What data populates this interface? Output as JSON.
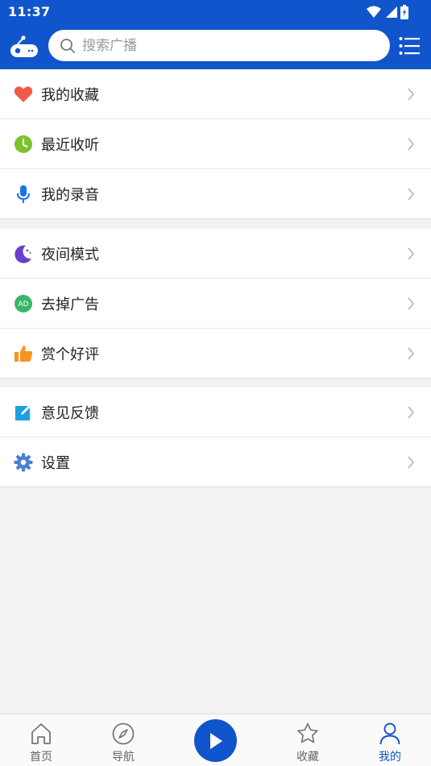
{
  "status_bar": {
    "time": "11:37"
  },
  "header": {
    "search_placeholder": "搜索广播"
  },
  "groups": [
    {
      "items": [
        {
          "label": "我的收藏",
          "icon": "heart-icon"
        },
        {
          "label": "最近收听",
          "icon": "clock-icon"
        },
        {
          "label": "我的录音",
          "icon": "microphone-icon"
        }
      ]
    },
    {
      "items": [
        {
          "label": "夜间模式",
          "icon": "moon-icon"
        },
        {
          "label": "去掉广告",
          "icon": "ad-icon"
        },
        {
          "label": "赏个好评",
          "icon": "thumbs-up-icon"
        }
      ]
    },
    {
      "items": [
        {
          "label": "意见反馈",
          "icon": "edit-icon"
        },
        {
          "label": "设置",
          "icon": "gear-icon"
        }
      ]
    }
  ],
  "bottom_nav": {
    "home": "首页",
    "navigate": "导航",
    "favorites": "收藏",
    "mine": "我的"
  },
  "colors": {
    "primary": "#1155cc",
    "heart": "#f05a4a",
    "clock": "#7cc12e",
    "mic": "#1a73e8",
    "moon": "#6a3fd0",
    "ad": "#3bb56c",
    "thumb": "#f7931e",
    "edit": "#1ba1e2",
    "gear": "#4a7fd6"
  }
}
